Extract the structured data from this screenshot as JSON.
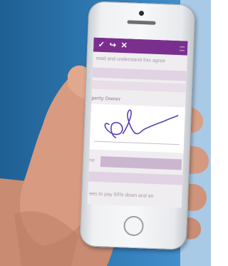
{
  "toolbar": {
    "accept_icon": "check-icon",
    "redo_icon": "redo-icon",
    "close_icon": "close-icon",
    "menu_icon": "menu-icon"
  },
  "document": {
    "line1": "read and understand this agree",
    "signature_label": "perty Owner",
    "field_label": "ne",
    "footer_line": "ees to pay 50% down and an"
  },
  "colors": {
    "toolbar": "#7a2f8f",
    "background_blue": "#2a72aa",
    "background_light": "#a9cae6",
    "signature_ink": "#5a3fb5"
  }
}
